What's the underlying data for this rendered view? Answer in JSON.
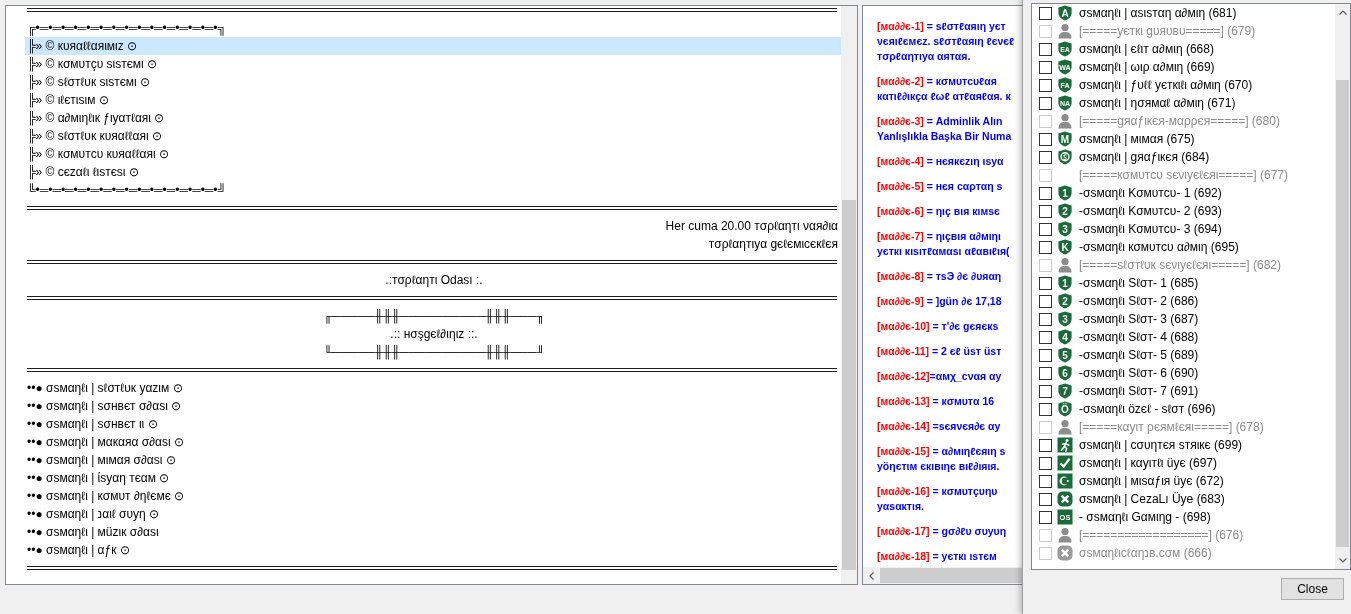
{
  "channel_tree": [
    {
      "kind": "rule"
    },
    {
      "kind": "left",
      "name": "╔•═•═•═•═•═•═•═•═•═•═•═•═•═•═•╗",
      "selected": false
    },
    {
      "kind": "left",
      "name": "╠» © кυяαℓℓαяιмιz ⊙",
      "selected": true
    },
    {
      "kind": "left",
      "name": "╠» © кσмυтçυ ѕιѕтємι ⊙",
      "selected": false
    },
    {
      "kind": "left",
      "name": "╠» © ѕℓσтℓυк ѕιѕтємι ⊙",
      "selected": false
    },
    {
      "kind": "left",
      "name": "╠» © ιℓєтιѕιм ⊙",
      "selected": false
    },
    {
      "kind": "left",
      "name": "╠» © α∂мιηℓιк ƒιуαтℓαяι ⊙",
      "selected": false
    },
    {
      "kind": "left",
      "name": "╠» © ѕℓσтℓυк кυяαℓℓαяι ⊙",
      "selected": false
    },
    {
      "kind": "left",
      "name": "╠» © кσмυтcυ кυяαℓℓαяι ⊙",
      "selected": false
    },
    {
      "kind": "left",
      "name": "╠» © cєzαℓι ℓιѕтєѕι ⊙",
      "selected": false
    },
    {
      "kind": "left",
      "name": "╚•═•═•═•═•═•═•═•═•═•═•═•═•═•═•╝",
      "selected": false
    },
    {
      "kind": "rule"
    },
    {
      "kind": "right",
      "name": "Her cuma 20.00 тσρℓαηтι ναя∂ια",
      "selected": false
    },
    {
      "kind": "right",
      "name": "тσρℓαηтιуα gєℓємιcєкℓєя",
      "selected": false
    },
    {
      "kind": "rule"
    },
    {
      "kind": "center",
      "name": ".:тσρℓαηтι Odası :.",
      "selected": false
    },
    {
      "kind": "rule"
    },
    {
      "kind": "center",
      "name": "╓─────╫╫╫──────────╫╫╫───╖",
      "selected": false
    },
    {
      "kind": "center",
      "name": ".:: нσşgєℓ∂ιηιz ::.",
      "selected": false
    },
    {
      "kind": "center",
      "name": "╙─────╫╫╫──────────╫╫╫───╜",
      "selected": false
    },
    {
      "kind": "rule"
    },
    {
      "kind": "left",
      "name": "••● σѕмαηℓι | ѕℓσтℓυк уαzιм ⊙",
      "selected": false
    },
    {
      "kind": "left",
      "name": "••● σѕмαηℓι | ѕσнвєт σ∂αѕι ⊙",
      "selected": false
    },
    {
      "kind": "left",
      "name": "••● σѕмαηℓι | ѕσнвєт ιι ⊙",
      "selected": false
    },
    {
      "kind": "left",
      "name": "••● σѕмαηℓι | мαкαяα σ∂αѕι ⊙",
      "selected": false
    },
    {
      "kind": "left",
      "name": "••● σѕмαηℓι | мιмαя σ∂αѕι ⊙",
      "selected": false
    },
    {
      "kind": "left",
      "name": "••● σѕмαηℓι | ίѕуαη тєαм ⊙",
      "selected": false
    },
    {
      "kind": "left",
      "name": "••● σѕмαηℓι | кσмυт ∂ηℓємє ⊙",
      "selected": false
    },
    {
      "kind": "left",
      "name": "••● σѕмαηℓι | נαιℓ συуη ⊙",
      "selected": false
    },
    {
      "kind": "left",
      "name": "••● σѕмαηℓι | мüzιк σ∂αѕι",
      "selected": false
    },
    {
      "kind": "left",
      "name": "••● σѕмαηℓι | αƒк ⊙",
      "selected": false
    },
    {
      "kind": "rule"
    }
  ],
  "channel_description": {
    "rules": [
      {
        "label": "[мα∂∂є-1]",
        "lines": [
          " = ѕℓσтℓαяιη уєт",
          "νєяιℓємєz. ѕℓσтℓαяιη ℓєνєℓ",
          "тσρℓαηтιуα αятαя."
        ]
      },
      {
        "label": "[мα∂∂є-2]",
        "lines": [
          " = кσмυтcυℓαя",
          "кαтιℓ∂ιкçα ℓωℓ αтℓαяℓαя. к"
        ]
      },
      {
        "label": "[мα∂∂є-3]",
        "lines": [
          " = Adminlik Alın",
          "Yanlışlıkla Başka Bir Numa"
        ]
      },
      {
        "label": "[мα∂∂є-4]",
        "lines": [
          " = нєякєzιη ιѕуα"
        ]
      },
      {
        "label": "[мα∂∂є-5]",
        "lines": [
          " = нєя cαρтαη ѕ"
        ]
      },
      {
        "label": "[мα∂∂є-6]",
        "lines": [
          " = ηιç вιя кιмѕє"
        ]
      },
      {
        "label": "[мα∂∂є-7]",
        "lines": [
          " = ηιçвιя α∂мιηι",
          "уєткι кιѕιтℓαмαѕι αℓαвιℓιя("
        ]
      },
      {
        "label": "[мα∂∂є-8]",
        "lines": [
          " = тѕЭ ∂є ∂υяαη"
        ]
      },
      {
        "label": "[мα∂∂є-9]",
        "lines": [
          " = ]gün ∂є 17,18"
        ]
      },
      {
        "label": "[мα∂∂є-10]",
        "lines": [
          " = т'∂є gєяєкѕ"
        ]
      },
      {
        "label": "[мα∂∂є-11]",
        "lines": [
          " = 2 єℓ üѕт üѕт"
        ]
      },
      {
        "label": "[мα∂∂є-12]",
        "lines": [
          "=αмχ_cναя αу"
        ]
      },
      {
        "label": "[мα∂∂є-13]",
        "lines": [
          " = кσмυтα 16"
        ]
      },
      {
        "label": "[мα∂∂є-14]",
        "lines": [
          " =ѕєяνєя∂є αу"
        ]
      },
      {
        "label": "[мα∂∂є-15]",
        "lines": [
          " = α∂мιηℓєяιη ѕ",
          "уöηєтιм єкιвιηє вιℓ∂ιяιя."
        ]
      },
      {
        "label": "[мα∂∂є-16]",
        "lines": [
          " = кσмυтçυηυ",
          "уαѕαктιя."
        ]
      },
      {
        "label": "[мα∂∂є-17]",
        "lines": [
          " = gσ∂ℓυ συуυη"
        ]
      },
      {
        "label": "[мα∂∂є-18]",
        "lines": [
          " = уєткι ιѕтєм"
        ]
      }
    ]
  },
  "server_groups_dialog": {
    "groups": [
      {
        "kind": "shield",
        "badge": "A",
        "label": "σѕмαηℓι | αѕιѕтαη α∂мιη (681)",
        "checked": false,
        "disabled": false
      },
      {
        "kind": "person",
        "label": "[=====уєткι gυяυвυ=====] (679)",
        "checked": false,
        "disabled": true
      },
      {
        "kind": "shield",
        "badge": "EA",
        "label": "σѕмαηℓι | єℓιт α∂мιη (668)",
        "checked": false,
        "disabled": false
      },
      {
        "kind": "shield",
        "badge": "WA",
        "label": "σѕмαηℓι | ωιρ α∂мιη (669)",
        "checked": false,
        "disabled": false
      },
      {
        "kind": "shield",
        "badge": "FA",
        "label": "σѕмαηℓι | ƒυℓℓ уєткιℓι α∂мιη (670)",
        "checked": false,
        "disabled": false
      },
      {
        "kind": "shield",
        "badge": "NA",
        "label": "σѕмαηℓι | ησямαℓ α∂мιη (671)",
        "checked": false,
        "disabled": false
      },
      {
        "kind": "person",
        "label": "[=====gяαƒιкєя-мαρρєя=====] (680)",
        "checked": false,
        "disabled": true
      },
      {
        "kind": "shield",
        "badge": "M",
        "label": "σѕмαηℓι | мιмαя (675)",
        "checked": false,
        "disabled": false
      },
      {
        "kind": "ring",
        "label": "σѕмαηℓι | gяαƒιкєя (684)",
        "checked": false,
        "disabled": false
      },
      {
        "kind": "blank",
        "label": "[=====кσмυтcυ ѕєνιуєℓєяι=====] (677)",
        "checked": false,
        "disabled": true
      },
      {
        "kind": "shield",
        "badge": "1",
        "label": "-σѕмαηℓι Kσмυтcυ- 1 (692)",
        "checked": false,
        "disabled": false
      },
      {
        "kind": "shield",
        "badge": "2",
        "label": "-σѕмαηℓι Kσмυтcυ- 2 (693)",
        "checked": false,
        "disabled": false
      },
      {
        "kind": "shield",
        "badge": "3",
        "label": "-σѕмαηℓι Kσмυтcυ- 3 (694)",
        "checked": false,
        "disabled": false
      },
      {
        "kind": "shield",
        "badge": "K",
        "label": "-σѕмαηℓι кσмυтcυ α∂мιη (695)",
        "checked": false,
        "disabled": false
      },
      {
        "kind": "person",
        "label": "[=====ѕℓσтℓυк ѕєνιуєℓєяι=====] (682)",
        "checked": false,
        "disabled": true
      },
      {
        "kind": "shield",
        "badge": "1",
        "label": "-σѕмαηℓι Sℓσт- 1 (685)",
        "checked": false,
        "disabled": false
      },
      {
        "kind": "shield",
        "badge": "2",
        "label": "-σѕмαηℓι Sℓσт- 2 (686)",
        "checked": false,
        "disabled": false
      },
      {
        "kind": "shield",
        "badge": "3",
        "label": "-σѕмαηℓι Sℓσт- 3 (687)",
        "checked": false,
        "disabled": false
      },
      {
        "kind": "shield",
        "badge": "4",
        "label": "-σѕмαηℓι Sℓσт- 4 (688)",
        "checked": false,
        "disabled": false
      },
      {
        "kind": "shield",
        "badge": "5",
        "label": "-σѕмαηℓι Sℓσт- 5 (689)",
        "checked": false,
        "disabled": false
      },
      {
        "kind": "shield",
        "badge": "6",
        "label": "-σѕмαηℓι Sℓσт- 6 (690)",
        "checked": false,
        "disabled": false
      },
      {
        "kind": "shield",
        "badge": "7",
        "label": "-σѕмαηℓι Sℓσт- 7 (691)",
        "checked": false,
        "disabled": false
      },
      {
        "kind": "shield",
        "badge": "Ö",
        "label": "-σѕмαηℓι özєℓ - ѕℓσт (696)",
        "checked": false,
        "disabled": false
      },
      {
        "kind": "person",
        "label": "[=====кαуιт ρєямℓєяι=====] (678)",
        "checked": false,
        "disabled": true
      },
      {
        "kind": "runner",
        "label": "σѕмαηℓι | cσυηтєя ѕтяιкє (699)",
        "checked": false,
        "disabled": false
      },
      {
        "kind": "check",
        "label": "σѕмαηℓι | кαуιтℓι üує (697)",
        "checked": false,
        "disabled": false
      },
      {
        "kind": "crescent",
        "label": "σѕмαηℓι | мιѕαƒιя üує (672)",
        "checked": false,
        "disabled": false
      },
      {
        "kind": "cross",
        "label": "σѕмαηℓι | CezaLı Üye (683)",
        "checked": false,
        "disabled": false
      },
      {
        "kind": "tile",
        "badge": "OS",
        "label": "- σѕмαηℓι Gαмιηg - (698)",
        "checked": false,
        "disabled": false
      },
      {
        "kind": "person",
        "label": "[==================] (676)",
        "checked": false,
        "disabled": true
      },
      {
        "kind": "cross",
        "label": "σѕмαηℓιcℓαηנв.cσм (666)",
        "checked": false,
        "disabled": true
      }
    ],
    "close_button": "Close"
  }
}
